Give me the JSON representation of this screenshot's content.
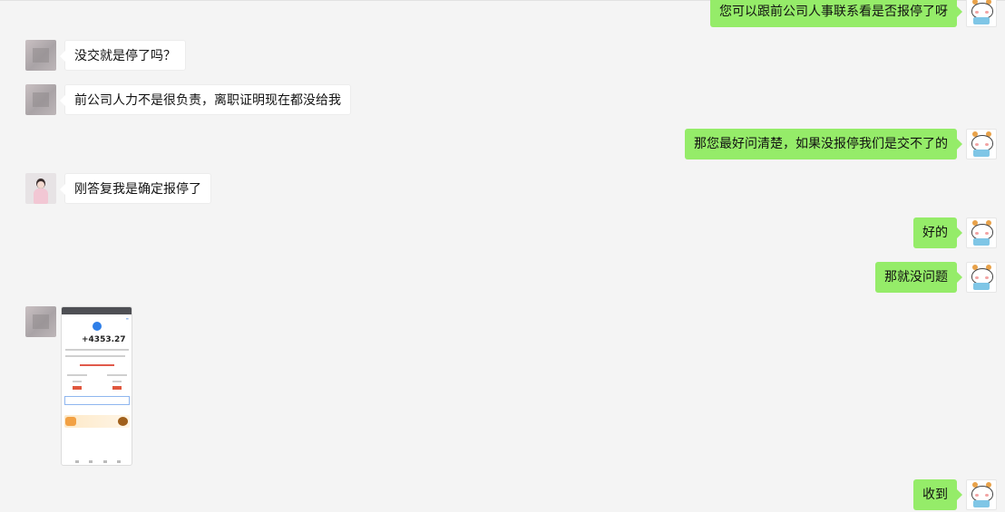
{
  "theme": {
    "background": "#f4f4f4",
    "incoming_bubble": "#ffffff",
    "outgoing_bubble": "#95ec69"
  },
  "messages": [
    {
      "side": "right",
      "text": "您可以跟前公司人事联系看是否报停了呀",
      "avatar": "cartoon-cat-avatar"
    },
    {
      "side": "left",
      "text": "没交就是停了吗？",
      "avatar": "blurred-avatar"
    },
    {
      "side": "left",
      "text": "前公司人力不是很负责，离职证明现在都没给我",
      "avatar": "blurred-avatar"
    },
    {
      "side": "right",
      "text": "那您最好问清楚，如果没报停我们是交不了的",
      "avatar": "cartoon-cat-avatar"
    },
    {
      "side": "left",
      "text": "刚答复我是确定报停了",
      "avatar": "girl-avatar"
    },
    {
      "side": "right",
      "text": "好的",
      "avatar": "cartoon-cat-avatar"
    },
    {
      "side": "right",
      "text": "那就没问题",
      "avatar": "cartoon-cat-avatar"
    },
    {
      "side": "left",
      "type": "image",
      "avatar": "blurred-avatar",
      "image": {
        "amount": "+4353.27"
      }
    },
    {
      "side": "right",
      "text": "收到",
      "avatar": "cartoon-cat-avatar"
    }
  ]
}
